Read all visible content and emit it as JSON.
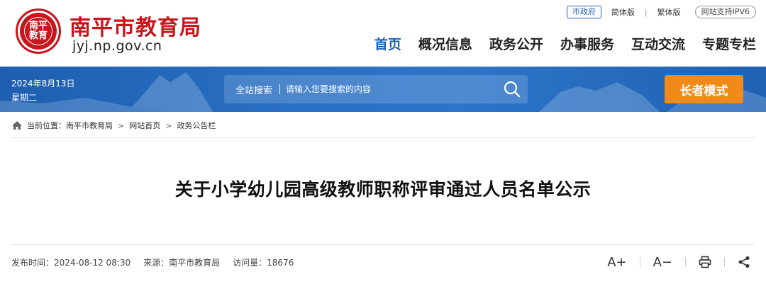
{
  "header": {
    "emblem_lines": [
      "南平",
      "教育"
    ],
    "site_name": "南平市教育局",
    "domain": "jyj.np.gov.cn",
    "top_links": {
      "gov": "市政府",
      "simplified": "简体版",
      "traditional": "繁体版",
      "ipv6": "网站支持IPV6"
    },
    "nav": [
      "首页",
      "概况信息",
      "政务公开",
      "办事服务",
      "互动交流",
      "专题专栏"
    ],
    "nav_active_index": 0
  },
  "banner": {
    "date": "2024年8月13日",
    "weekday": "星期二",
    "search_label": "全站搜索",
    "search_placeholder": "请输入您要搜索的内容",
    "elder_mode": "长者模式"
  },
  "breadcrumb": {
    "prefix": "当前位置：",
    "items": [
      "南平市教育局",
      "网站首页",
      "政务公告栏"
    ],
    "separator": ">"
  },
  "article": {
    "title": "关于小学幼儿园高级教师职称评审通过人员名单公示",
    "publish_time": "发布时间：2024-08-12 08:30",
    "source": "来源：南平市教育局",
    "views": "访问量：18676",
    "tools": {
      "font_increase": "A+",
      "font_decrease": "A−"
    }
  },
  "colors": {
    "brand_red": "#c8161d",
    "nav_active_blue": "#1e5fb4",
    "banner_blue": "#2a70c4",
    "elder_orange": "#f18a18"
  },
  "icons": [
    "home-icon",
    "search-icon",
    "print-icon",
    "share-icon"
  ]
}
